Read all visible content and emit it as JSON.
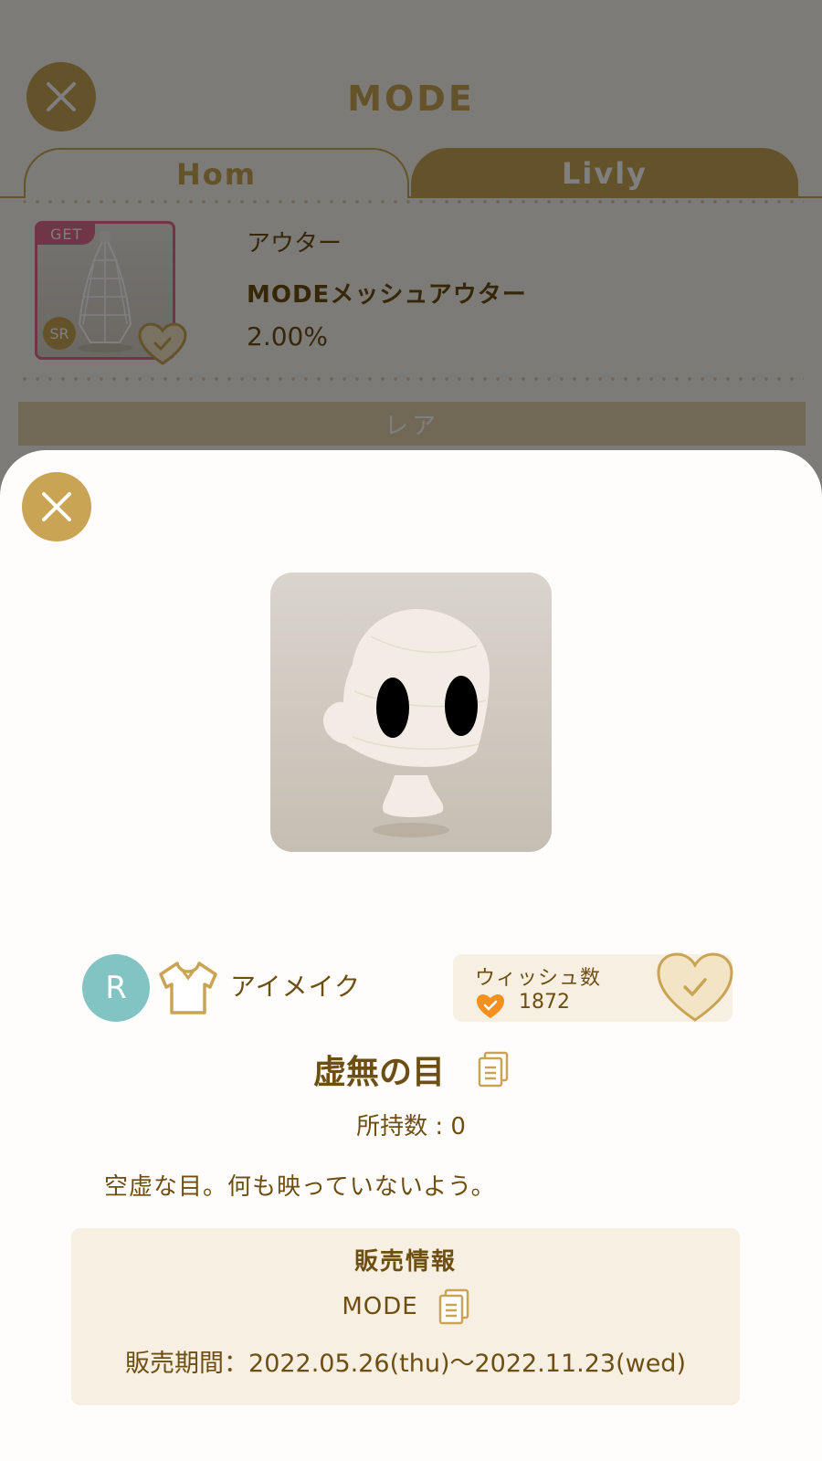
{
  "background": {
    "title": "MODE",
    "tabs": [
      "Hom",
      "Livly"
    ],
    "item": {
      "badge_get": "GET",
      "badge_rarity": "SR",
      "category": "アウター",
      "name": "MODEメッシュアウター",
      "rate": "2.00%"
    },
    "rarity_header": "レア"
  },
  "modal": {
    "rarity_badge": "R",
    "category_icon": "shirt-icon",
    "category": "アイメイク",
    "wish": {
      "label": "ウィッシュ数",
      "count": "1872"
    },
    "item_name": "虚無の目",
    "owned": "所持数 : 0",
    "description": "空虚な目。何も映っていないよう。",
    "sales": {
      "header": "販売情報",
      "shop": "MODE",
      "period": "販売期間：2022.05.26(thu)～2022.11.23(wed)"
    }
  },
  "colors": {
    "accent": "#c9a455",
    "text": "#6e4f13",
    "panel": "#f7efe1",
    "rarity_r": "#82c3c4",
    "get_pink": "#e06a8c",
    "heart_orange": "#f4901e"
  }
}
